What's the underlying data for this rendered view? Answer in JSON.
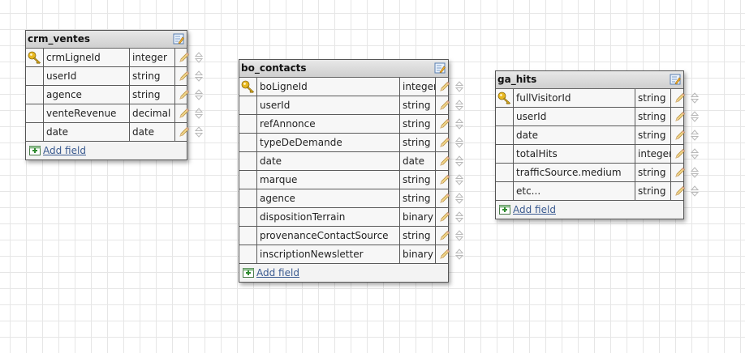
{
  "tables": [
    {
      "title": "crm_ventes",
      "add_label": "Add field",
      "fields": [
        {
          "name": "crmLigneId",
          "type": "integer",
          "primary_key": true
        },
        {
          "name": "userId",
          "type": "string",
          "primary_key": false
        },
        {
          "name": "agence",
          "type": "string",
          "primary_key": false
        },
        {
          "name": "venteRevenue",
          "type": "decimal",
          "primary_key": false
        },
        {
          "name": "date",
          "type": "date",
          "primary_key": false
        }
      ]
    },
    {
      "title": "bo_contacts",
      "add_label": "Add field",
      "fields": [
        {
          "name": "boLigneId",
          "type": "integer",
          "primary_key": true
        },
        {
          "name": "userId",
          "type": "string",
          "primary_key": false
        },
        {
          "name": "refAnnonce",
          "type": "string",
          "primary_key": false
        },
        {
          "name": "typeDeDemande",
          "type": "string",
          "primary_key": false
        },
        {
          "name": "date",
          "type": "date",
          "primary_key": false
        },
        {
          "name": "marque",
          "type": "string",
          "primary_key": false
        },
        {
          "name": "agence",
          "type": "string",
          "primary_key": false
        },
        {
          "name": "dispositionTerrain",
          "type": "binary",
          "primary_key": false
        },
        {
          "name": "provenanceContactSource",
          "type": "string",
          "primary_key": false
        },
        {
          "name": "inscriptionNewsletter",
          "type": "binary",
          "primary_key": false
        }
      ]
    },
    {
      "title": "ga_hits",
      "add_label": "Add field",
      "fields": [
        {
          "name": "fullVisitorId",
          "type": "string",
          "primary_key": true
        },
        {
          "name": "userId",
          "type": "string",
          "primary_key": false
        },
        {
          "name": "date",
          "type": "string",
          "primary_key": false
        },
        {
          "name": "totalHits",
          "type": "integer",
          "primary_key": false
        },
        {
          "name": "trafficSource.medium",
          "type": "string",
          "primary_key": false
        },
        {
          "name": "etc...",
          "type": "string",
          "primary_key": false
        }
      ]
    }
  ],
  "icons": {
    "primary_key": "key-icon",
    "edit_table": "edit-table-icon",
    "edit_field": "pencil-icon",
    "reorder_field": "reorder-icon",
    "add_field": "add-field-icon"
  },
  "colors": {
    "link": "#3a5a90",
    "border": "#555555",
    "header": "#d8d8d8",
    "key": "#d4a017"
  }
}
